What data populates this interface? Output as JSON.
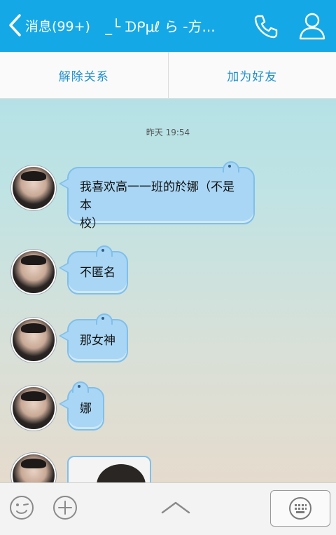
{
  "header": {
    "back_label": "消息(99+)",
    "title": "_└ ᗪᑭμℓ ら -方...",
    "icons": {
      "back": "chevron-left-icon",
      "phone": "phone-icon",
      "profile": "person-icon"
    }
  },
  "actions": {
    "remove_relation": "解除关系",
    "add_friend": "加为好友"
  },
  "chat": {
    "timestamp": "昨天 19:54",
    "messages": [
      {
        "text": "我喜欢高一一班的於娜（不是本校）",
        "line1": "我喜欢高一一班的於娜（不是本",
        "line2": "校）"
      },
      {
        "text": "不匿名"
      },
      {
        "text": "那女神"
      },
      {
        "text": "娜"
      },
      {
        "type": "image"
      }
    ]
  },
  "bottom_bar": {
    "icons": [
      "emoji-icon",
      "plus-icon",
      "chevron-up-icon",
      "keyboard-icon"
    ]
  },
  "colors": {
    "header_bg": "#14a9e6",
    "bubble_bg": "#a9d6f5",
    "bubble_border": "#7fbfeb",
    "action_text": "#1d8fcc"
  }
}
